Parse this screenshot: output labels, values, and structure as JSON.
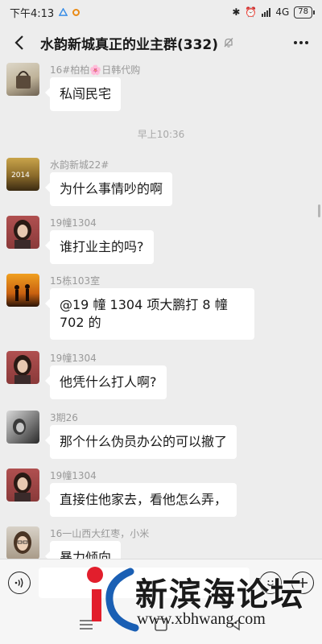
{
  "status_bar": {
    "time": "下午4:13",
    "network": "4G",
    "battery": "78"
  },
  "header": {
    "title": "水韵新城真正的业主群(332)"
  },
  "chat": {
    "messages": [
      {
        "sender": "16#柏柏🌸日韩代购",
        "text": "私闯民宅",
        "avatar": "avatar-handbag"
      },
      {
        "timestamp": "早上10:36"
      },
      {
        "sender": "水韵新城22#",
        "text": "为什么事情吵的啊",
        "avatar": "avatar-sunset-2014"
      },
      {
        "sender": "19幢1304",
        "text": "谁打业主的吗?",
        "avatar": "avatar-woman"
      },
      {
        "sender": "15栋103室",
        "text": "@19 幢 1304  项大鹏打 8 幢 702 的",
        "avatar": "avatar-couple-sunset"
      },
      {
        "sender": "19幢1304",
        "text": "他凭什么打人啊?",
        "avatar": "avatar-woman"
      },
      {
        "sender": "3期26",
        "text": "那个什么伪员办公的可以撤了",
        "avatar": "avatar-bw-girl"
      },
      {
        "sender": "19幢1304",
        "text": "直接住他家去，看他怎么弄，",
        "avatar": "avatar-woman"
      },
      {
        "sender": "16一山西大红枣，小米",
        "text": "暴力倾向",
        "avatar": "avatar-glasses-woman"
      }
    ]
  },
  "input_bar": {
    "placeholder": ""
  },
  "watermark": {
    "name": "新滨海论坛",
    "url": "www.xbhwang.com"
  },
  "colors": {
    "background": "#ededed",
    "bubble": "#ffffff",
    "meta_text": "#9a9a9a",
    "watermark_red": "#e21e2c",
    "watermark_blue": "#1a5fb4"
  }
}
